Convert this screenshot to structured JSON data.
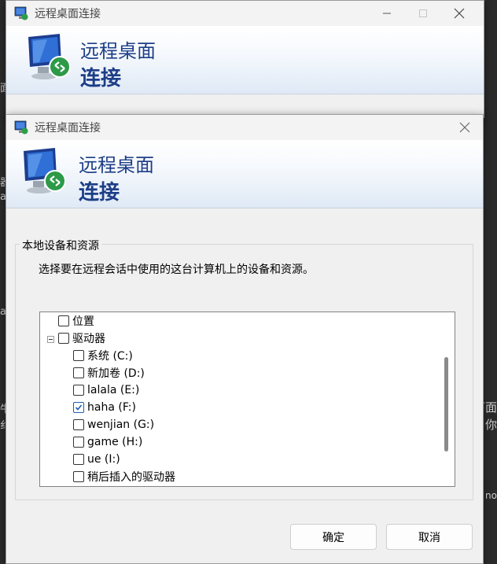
{
  "background": {
    "left_fragments": [
      "面",
      "器",
      "a",
      "a",
      "牛",
      "纟"
    ],
    "right_fragments": [
      "下面",
      "你",
      "no"
    ]
  },
  "back_window": {
    "title": "远程桌面连接",
    "banner_line1": "远程桌面",
    "banner_line2": "连接"
  },
  "front_window": {
    "title": "远程桌面连接",
    "banner_line1": "远程桌面",
    "banner_line2": "连接",
    "group_title": "本地设备和资源",
    "description": "选择要在远程会话中使用的这台计算机上的设备和资源。",
    "tree_items": [
      {
        "label": "位置",
        "checked": false
      },
      {
        "label": "驱动器",
        "checked": false
      },
      {
        "label": "系统 (C:)",
        "checked": false
      },
      {
        "label": "新加卷 (D:)",
        "checked": false
      },
      {
        "label": "lalala (E:)",
        "checked": false
      },
      {
        "label": "haha (F:)",
        "checked": true
      },
      {
        "label": "wenjian (G:)",
        "checked": false
      },
      {
        "label": "game (H:)",
        "checked": false
      },
      {
        "label": "ue (I:)",
        "checked": false
      },
      {
        "label": "稍后插入的驱动器",
        "checked": false
      }
    ],
    "ok_label": "确定",
    "cancel_label": "取消"
  },
  "icons": {
    "app": "remote-desktop-icon",
    "close": "close-icon",
    "minimize": "minimize-icon",
    "maximize": "maximize-icon",
    "check": "checkmark-icon",
    "expander": "collapse-minus-icon"
  },
  "colors": {
    "banner_text": "#1d3e87",
    "check": "#1f5fb4"
  }
}
